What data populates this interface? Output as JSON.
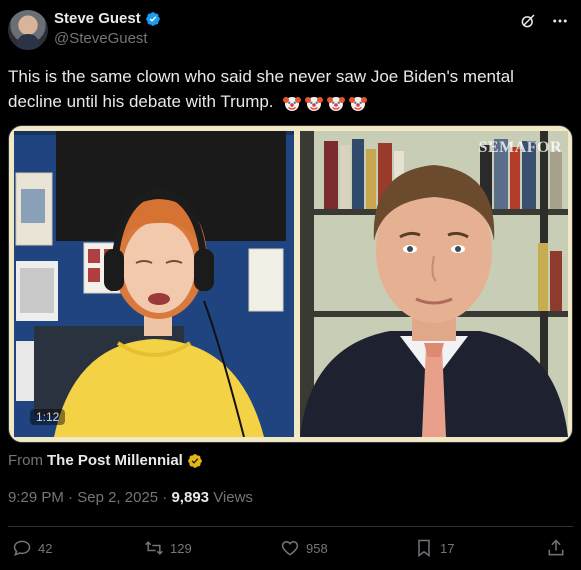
{
  "author": {
    "name": "Steve Guest",
    "handle": "@SteveGuest"
  },
  "tweet": {
    "text": "This is the same clown who said she never saw Joe Biden's mental decline until his debate with Trump.",
    "emojis": [
      "clown-face",
      "clown-face",
      "clown-face",
      "clown-face"
    ]
  },
  "media": {
    "watermark": "SEMAFOR",
    "duration": "1:12"
  },
  "source": {
    "prefix": "From",
    "name": "The Post Millennial"
  },
  "meta": {
    "time": "9:29 PM",
    "separator1": "·",
    "date": "Sep 2, 2025",
    "separator2": "·",
    "views_count": "9,893",
    "views_label": "Views"
  },
  "actions": {
    "replies": "42",
    "reposts": "129",
    "likes": "958",
    "bookmarks": "17"
  },
  "colors": {
    "background": "#000000",
    "text": "#e7e9ea",
    "muted": "#71767b",
    "verified_blue": "#1d9bf0",
    "verified_gold": "#e2b719",
    "divider": "#2f3336"
  }
}
